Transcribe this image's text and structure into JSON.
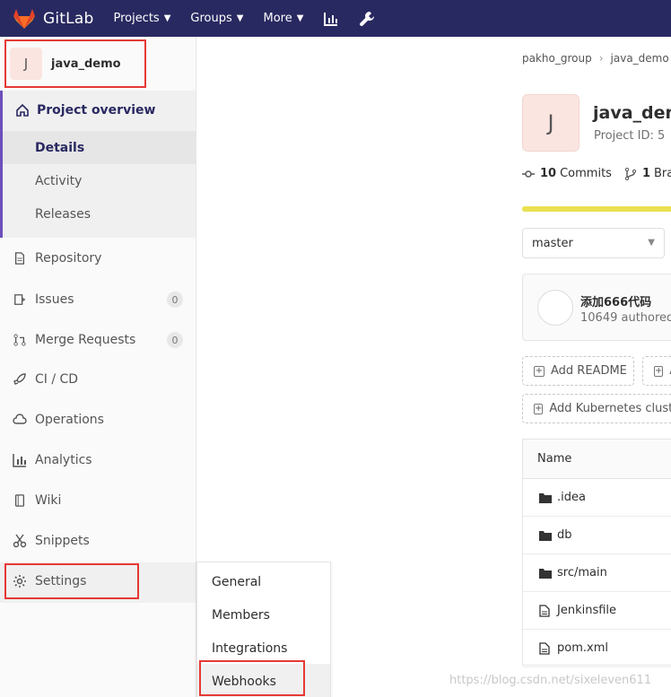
{
  "nav": {
    "brand": "GitLab",
    "projects": "Projects",
    "groups": "Groups",
    "more": "More"
  },
  "sidebar": {
    "project_avatar_letter": "J",
    "project_name": "java_demo",
    "overview": "Project overview",
    "overview_items": [
      "Details",
      "Activity",
      "Releases"
    ],
    "repository": "Repository",
    "issues": "Issues",
    "issues_count": "0",
    "merge_requests": "Merge Requests",
    "merge_requests_count": "0",
    "cicd": "CI / CD",
    "operations": "Operations",
    "analytics": "Analytics",
    "wiki": "Wiki",
    "snippets": "Snippets",
    "settings": "Settings"
  },
  "settings_flyout": [
    "General",
    "Members",
    "Integrations",
    "Webhooks"
  ],
  "main": {
    "breadcrumb": [
      "pakho_group",
      "java_demo"
    ],
    "avatar_letter": "J",
    "title": "java_dem",
    "project_id": "Project ID: 5",
    "commits_count": "10",
    "commits_label": "Commits",
    "branches_count": "1",
    "branches_label": "Bran",
    "branch": "master",
    "commit_title": "添加666代码",
    "commit_sub": "10649 authored",
    "add_readme": "Add README",
    "add_second": "A",
    "add_kubernetes": "Add Kubernetes cluste",
    "table_header": "Name",
    "files": [
      {
        "name": ".idea",
        "type": "folder"
      },
      {
        "name": "db",
        "type": "folder"
      },
      {
        "name": "src/main",
        "type": "folder"
      },
      {
        "name": "Jenkinsfile",
        "type": "file"
      },
      {
        "name": "pom.xml",
        "type": "file"
      }
    ]
  },
  "watermark": "https://blog.csdn.net/sixeleven611",
  "colors": {
    "topbar": "#292961",
    "accent": "#6b4fbb",
    "highlight_box": "#e53935",
    "progress": "#e9e151"
  }
}
